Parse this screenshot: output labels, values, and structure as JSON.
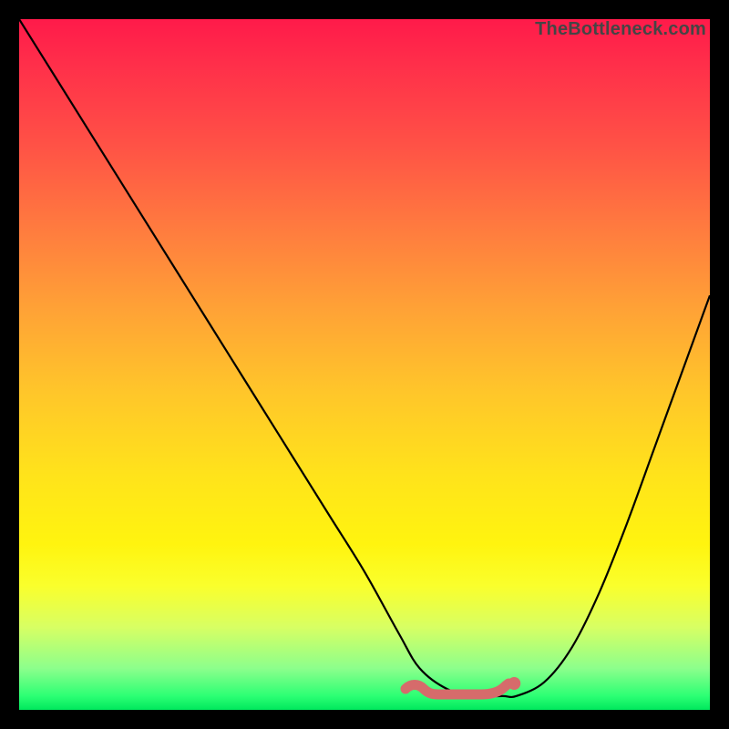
{
  "watermark": "TheBottleneck.com",
  "colors": {
    "frame_border": "#000000",
    "curve_stroke": "#000000",
    "marker_fill": "#d66b6b",
    "marker_stroke": "#d66b6b",
    "gradient_top": "#ff1a4a",
    "gradient_bottom": "#00e85d"
  },
  "chart_data": {
    "type": "line",
    "title": "",
    "xlabel": "",
    "ylabel": "",
    "x_range": [
      0,
      100
    ],
    "y_range": [
      0,
      100
    ],
    "series": [
      {
        "name": "bottleneck-curve",
        "x": [
          0,
          5,
          10,
          15,
          20,
          25,
          30,
          35,
          40,
          45,
          50,
          55,
          58,
          62,
          66,
          70,
          72,
          76,
          80,
          84,
          88,
          92,
          96,
          100
        ],
        "y": [
          100,
          92,
          84,
          76,
          68,
          60,
          52,
          44,
          36,
          28,
          20,
          11,
          6,
          3,
          2,
          2,
          2,
          4,
          9,
          17,
          27,
          38,
          49,
          60
        ]
      }
    ],
    "optimal_region": {
      "name": "optimal-band",
      "x_start": 56,
      "x_end": 72,
      "y": 2.5
    },
    "annotations": []
  }
}
